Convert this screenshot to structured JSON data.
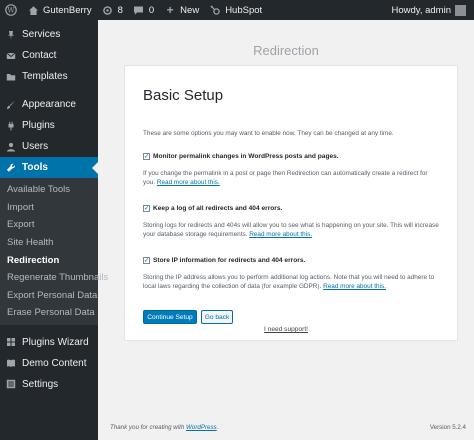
{
  "adminbar": {
    "site_name": "GutenBerry",
    "updates_count": "8",
    "comments_count": "0",
    "new_label": "New",
    "hubspot_label": "HubSpot",
    "howdy": "Howdy, admin"
  },
  "sidebar": {
    "top_items": [
      {
        "label": "Services",
        "icon": "pin-icon"
      },
      {
        "label": "Contact",
        "icon": "envelope-icon"
      },
      {
        "label": "Templates",
        "icon": "folder-icon"
      }
    ],
    "mid_items": [
      {
        "label": "Appearance",
        "icon": "paintbrush-icon"
      },
      {
        "label": "Plugins",
        "icon": "plug-icon"
      },
      {
        "label": "Users",
        "icon": "user-icon"
      }
    ],
    "current_item": {
      "label": "Tools",
      "icon": "wrench-icon"
    },
    "submenu": [
      "Available Tools",
      "Import",
      "Export",
      "Site Health",
      "Redirection",
      "Regenerate Thumbnails",
      "Export Personal Data",
      "Erase Personal Data"
    ],
    "bottom_items": [
      {
        "label": "Plugins Wizard",
        "icon": "grid-icon"
      },
      {
        "label": "Demo Content",
        "icon": "book-icon"
      },
      {
        "label": "Settings",
        "icon": "settings-icon"
      }
    ]
  },
  "page": {
    "heading": "Redirection",
    "card_title": "Basic Setup",
    "intro": "These are some options you may want to enable now. They can be changed at any time.",
    "options": [
      {
        "label": "Monitor permalink changes in WordPress posts and pages.",
        "checked": true,
        "desc_line1": "If you change the permalink in a post or page then Redirection can automatically create a redirect for",
        "desc_line2": "you.",
        "link": "Read more about this."
      },
      {
        "label": "Keep a log of all redirects and 404 errors.",
        "checked": true,
        "desc_line1": "Storing logs for redirects and 404s will allow you to see what is happening on your site. This will increase",
        "desc_line2": "your database storage requirements.",
        "link": "Read more about this."
      },
      {
        "label": "Store IP information for redirects and 404 errors.",
        "checked": true,
        "desc_line1": "Storing the IP address allows you to perform additional log actions. Note that you will need to adhere to",
        "desc_line2": "local laws regarding the collection of data (for example GDPR).",
        "link": "Read more about this."
      }
    ],
    "continue_button": "Continue Setup",
    "back_button": "Go back",
    "support_link": "I need support!"
  },
  "footer": {
    "thanks_prefix": "Thank you for creating with",
    "thanks_link": "WordPress",
    "thanks_suffix": ".",
    "version": "Version 5.2.4"
  },
  "colors": {
    "accent": "#0073aa",
    "sidebar_bg": "#23282d",
    "submenu_bg": "#32373c",
    "page_bg": "#f1f1f1"
  }
}
